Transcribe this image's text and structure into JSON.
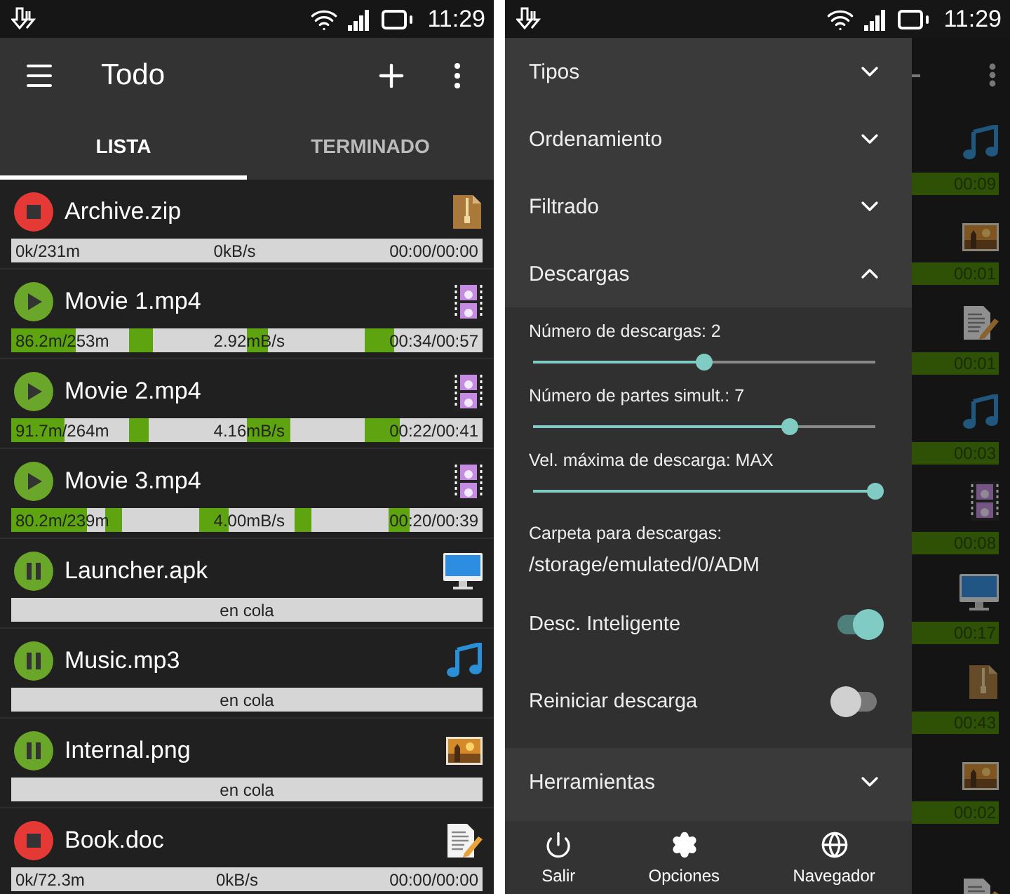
{
  "list_screen": {
    "status_bar": {
      "time": "11:29"
    },
    "toolbar": {
      "title": "Todo"
    },
    "tabs": [
      {
        "label": "LISTA",
        "selected": true
      },
      {
        "label": "TERMINADO",
        "selected": false
      }
    ],
    "downloads": [
      {
        "name": "Archive.zip",
        "control": {
          "kind": "stop"
        },
        "file_icon": {
          "kind": "zip"
        },
        "progress": {
          "downloaded": "0k/231m",
          "speed": "0kB/s",
          "time": "00:00/00:00",
          "level": 0
        }
      },
      {
        "name": "Movie 1.mp4",
        "control": {
          "kind": "play"
        },
        "file_icon": {
          "kind": "video"
        },
        "progress": {
          "downloaded": "86.2m/253m",
          "speed": "2.92mB/s",
          "time": "00:34/00:57",
          "parts": [
            {
              "level": 0.55
            },
            {
              "level": 0.2
            },
            {
              "level": 0.18
            },
            {
              "level": 0.25
            }
          ]
        }
      },
      {
        "name": "Movie 2.mp4",
        "control": {
          "kind": "play"
        },
        "file_icon": {
          "kind": "video"
        },
        "progress": {
          "downloaded": "91.7m/264m",
          "speed": "4.16mB/s",
          "time": "00:22/00:41",
          "parts": [
            {
              "level": 0.45
            },
            {
              "level": 0.17
            },
            {
              "level": 0.37
            },
            {
              "level": 0.3
            }
          ]
        }
      },
      {
        "name": "Movie 3.mp4",
        "control": {
          "kind": "play"
        },
        "file_icon": {
          "kind": "video"
        },
        "progress": {
          "downloaded": "80.2m/239m",
          "speed": "4.00mB/s",
          "time": "00:20/00:39",
          "parts": [
            {
              "level": 0.8
            },
            {
              "level": 0.17
            },
            {
              "level": 0.3
            },
            {
              "level": 0.18
            },
            {
              "level": 0.22
            }
          ]
        }
      },
      {
        "name": "Launcher.apk",
        "control": {
          "kind": "pause"
        },
        "file_icon": {
          "kind": "monitor"
        },
        "progress": {
          "status": "en cola",
          "level": 0
        }
      },
      {
        "name": "Music.mp3",
        "control": {
          "kind": "pause"
        },
        "file_icon": {
          "kind": "music"
        },
        "progress": {
          "status": "en cola",
          "level": 0
        }
      },
      {
        "name": "Internal.png",
        "control": {
          "kind": "pause"
        },
        "file_icon": {
          "kind": "image"
        },
        "progress": {
          "status": "en cola",
          "level": 0
        }
      },
      {
        "name": "Book.doc",
        "control": {
          "kind": "stop"
        },
        "file_icon": {
          "kind": "doc"
        },
        "progress": {
          "downloaded": "0k/72.3m",
          "speed": "0kB/s",
          "time": "00:00/00:00",
          "level": 0
        }
      }
    ]
  },
  "drawer_screen": {
    "status_bar": {
      "time": "11:29"
    },
    "sections": [
      {
        "title": "Tipos",
        "expanded": false
      },
      {
        "title": "Ordenamiento",
        "expanded": false
      },
      {
        "title": "Filtrado",
        "expanded": false
      },
      {
        "title": "Descargas",
        "expanded": true,
        "settings": [
          {
            "kind": "slider",
            "label": "Número de descargas: 2",
            "level": 0.5
          },
          {
            "kind": "slider",
            "label": "Número de partes simult.: 7",
            "level": 0.75
          },
          {
            "kind": "slider",
            "label": "Vel. máxima de descarga: MAX",
            "level": 1
          },
          {
            "kind": "folder",
            "label": "Carpeta para descargas:",
            "value": "/storage/emulated/0/ADM"
          },
          {
            "kind": "toggle",
            "label": "Desc. Inteligente",
            "on": true
          },
          {
            "kind": "toggle",
            "label": "Reiniciar descarga",
            "on": false
          }
        ]
      },
      {
        "title": "Herramientas",
        "expanded": false
      }
    ],
    "bottom_nav": [
      {
        "kind": "exit",
        "label": "Salir"
      },
      {
        "kind": "settings",
        "label": "Opciones"
      },
      {
        "kind": "browser",
        "label": "Navegador"
      }
    ],
    "background_list": [
      {
        "kind": "music",
        "time": "00:09"
      },
      {
        "kind": "image",
        "time": "00:01"
      },
      {
        "kind": "doc",
        "time": "00:01"
      },
      {
        "kind": "music",
        "time": "00:03"
      },
      {
        "kind": "video",
        "time": "00:08"
      },
      {
        "kind": "monitor",
        "time": "00:17"
      },
      {
        "kind": "zip",
        "time": "00:43"
      },
      {
        "kind": "image",
        "time": "00:02"
      },
      {
        "kind": "doc"
      }
    ]
  }
}
